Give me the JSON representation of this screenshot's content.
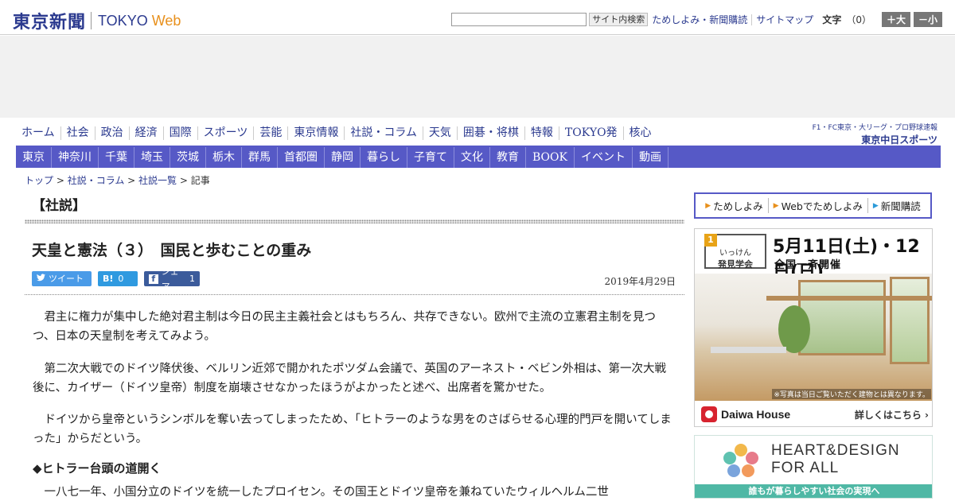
{
  "header": {
    "logo_jp": "東京新聞",
    "logo_en_1": "TOKYO",
    "logo_en_2": "Web",
    "search_placeholder": "",
    "search_button": "サイト内検索",
    "links": [
      "ためしよみ・新聞購読",
      "サイトマップ"
    ],
    "font_size_label": "文字",
    "font_size_count": "（0）",
    "font_larger": "＋大",
    "font_smaller": "－小"
  },
  "nav": {
    "main": [
      "ホーム",
      "社会",
      "政治",
      "経済",
      "国際",
      "スポーツ",
      "芸能",
      "東京情報",
      "社説・コラム",
      "天気",
      "囲碁・将棋",
      "特報",
      "TOKYO発",
      "核心"
    ],
    "chunichi_sub": "F1・FC東京・大リーグ・プロ野球速報",
    "chunichi_logo": "東京中日スポーツ",
    "sub": [
      "東京",
      "神奈川",
      "千葉",
      "埼玉",
      "茨城",
      "栃木",
      "群馬",
      "首都圏",
      "静岡",
      "暮らし",
      "子育て",
      "文化",
      "教育",
      "BOOK",
      "イベント",
      "動画"
    ]
  },
  "breadcrumb": {
    "items": [
      "トップ",
      "社説・コラム",
      "社説一覧",
      "記事"
    ],
    "separator": " > "
  },
  "article": {
    "section": "【社説】",
    "title": "天皇と憲法（３）　国民と歩むことの重み",
    "social": {
      "tweet": "ツイート",
      "hatena_b": "B!",
      "hatena_count": "0",
      "facebook_f": "f",
      "share": "シェア",
      "share_count": "1"
    },
    "date": "2019年4月29日",
    "paragraphs": [
      "君主に権力が集中した絶対君主制は今日の民主主義社会とはもちろん、共存できない。欧州で主流の立憲君主制を見つつ、日本の天皇制を考えてみよう。",
      "第二次大戦でのドイツ降伏後、ベルリン近郊で開かれたポツダム会議で、英国のアーネスト・ベビン外相は、第一次大戦後に、カイザー（ドイツ皇帝）制度を崩壊させなかったほうがよかったと述べ、出席者を驚かせた。",
      "ドイツから皇帝というシンボルを奪い去ってしまったため、「ヒトラーのような男をのさばらせる心理的門戸を開いてしまった」からだという。"
    ],
    "subheading": "◆ヒトラー台頭の道開く",
    "paragraph_4": "一八七一年、小国分立のドイツを統一したプロイセン。その国王とドイツ皇帝を兼ねていたウィルヘルム二世"
  },
  "sidebar": {
    "subscribe": [
      "ためしよみ",
      "Webでためしよみ",
      "新聞購読"
    ],
    "daiwa_ad": {
      "badge": "1",
      "event_line1": "いっけん",
      "event_line2": "発見学会",
      "date": "5月11日(土)・12日(日)",
      "sub": "全国一斉開催",
      "caption": "※写真は当日ご覧いただく建物とは異なります。",
      "brand": "Daiwa House",
      "more": "詳しくはこちら ›"
    },
    "heart_ad": {
      "title_line1": "HEART&DESIGN",
      "title_line2": "FOR ALL",
      "band": "誰もが暮らしやすい社会の実現へ"
    }
  },
  "colors": {
    "brand_blue": "#2b3a8f",
    "nav_purple": "#5659c6",
    "accent_orange": "#e8901c",
    "twitter": "#4a9be8",
    "hatena": "#2f9ae0",
    "facebook": "#3b5b9b",
    "heart_teal": "#4fb8a5"
  }
}
